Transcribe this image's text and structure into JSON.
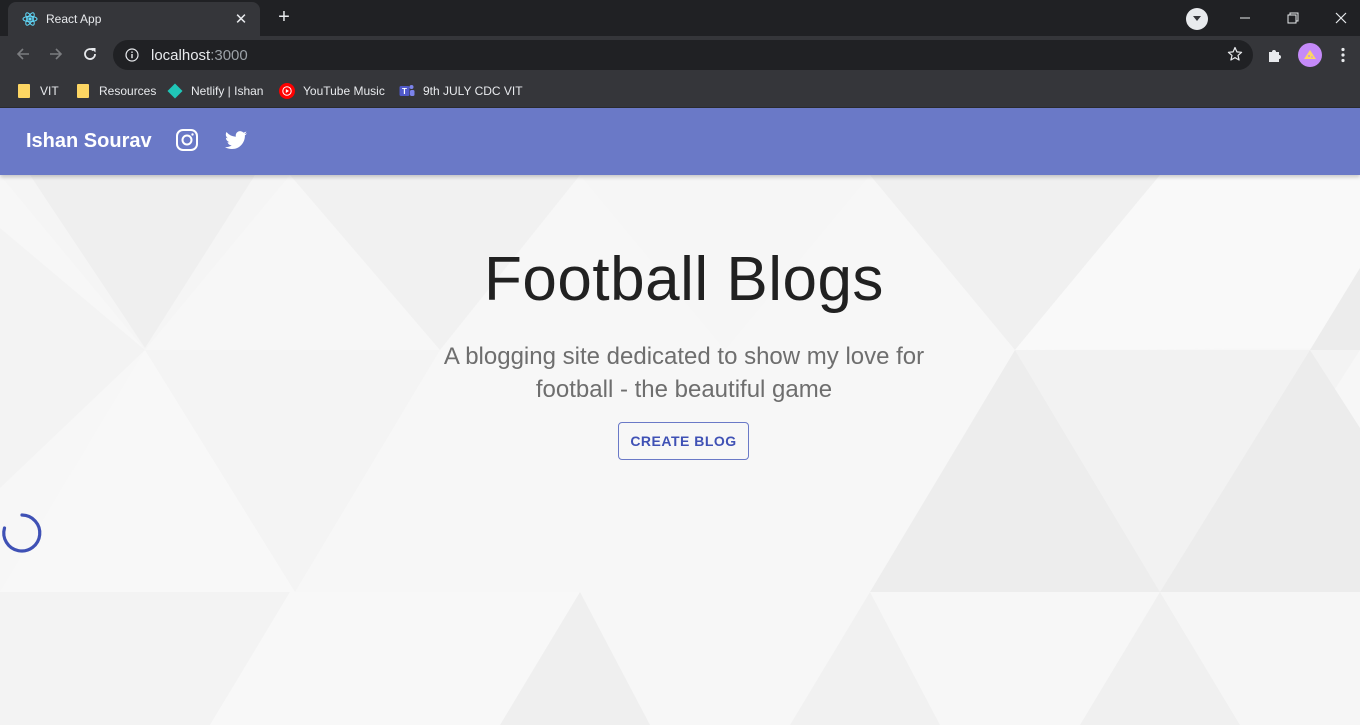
{
  "browser": {
    "tab": {
      "title": "React App",
      "favicon": "react-logo-icon"
    },
    "address": {
      "host": "localhost",
      "port": ":3000"
    },
    "bookmarks": [
      {
        "label": "VIT",
        "icon": "folder-icon"
      },
      {
        "label": "Resources",
        "icon": "folder-icon"
      },
      {
        "label": "Netlify | Ishan",
        "icon": "netlify-icon"
      },
      {
        "label": "YouTube Music",
        "icon": "youtube-music-icon"
      },
      {
        "label": "9th JULY CDC VIT",
        "icon": "teams-icon"
      }
    ]
  },
  "app": {
    "brand": "Ishan Sourav",
    "social": [
      "instagram-icon",
      "twitter-icon"
    ],
    "hero": {
      "title": "Football Blogs",
      "subtitle": "A blogging site dedicated to show my love for football - the beautiful game",
      "button": "CREATE BLOG"
    },
    "loading": true
  },
  "colors": {
    "appbar": "#6a79c7",
    "button_text": "#3f51b5",
    "spinner": "#3f51b5"
  }
}
